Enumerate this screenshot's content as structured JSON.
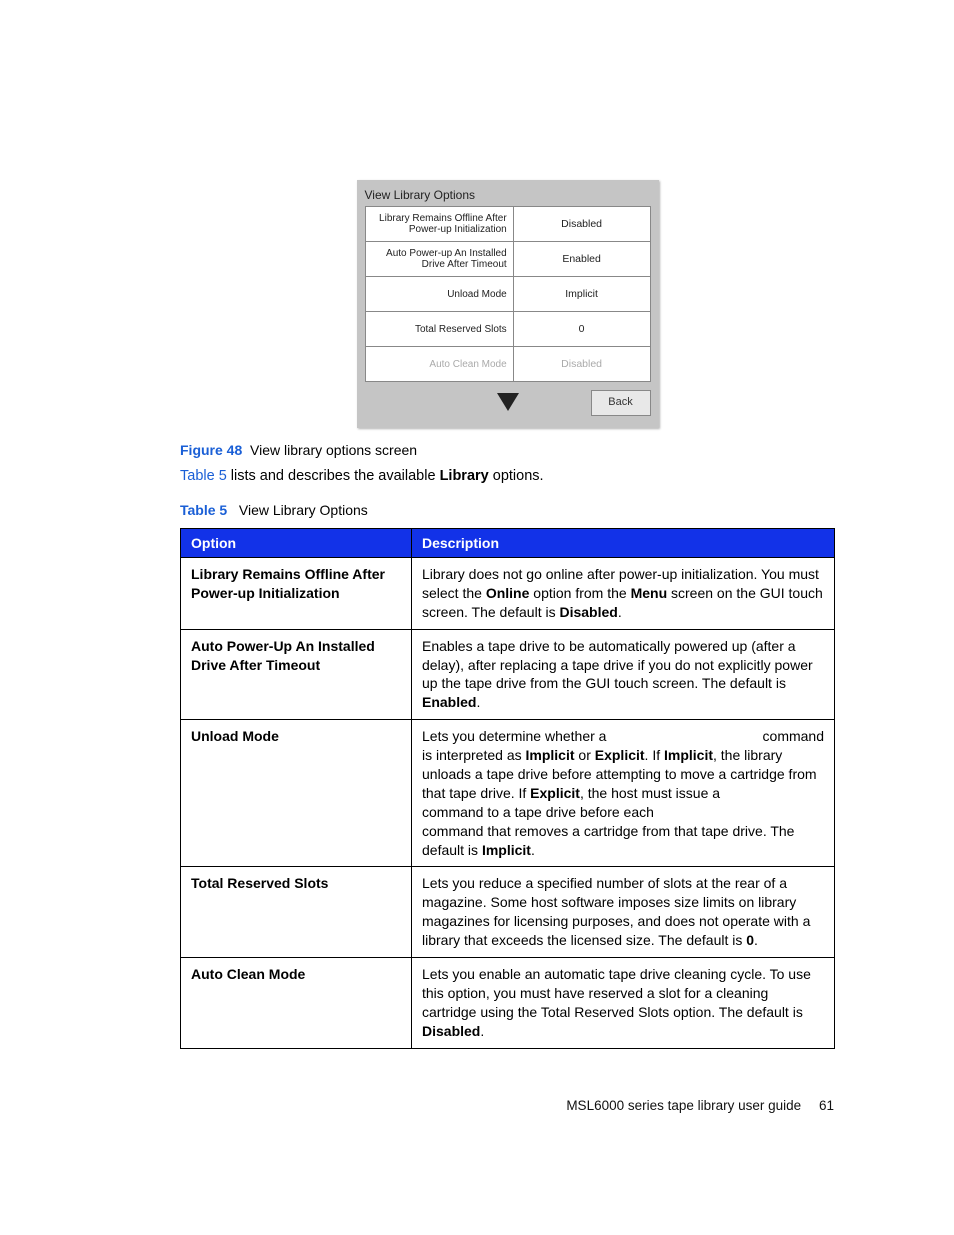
{
  "panel": {
    "title": "View Library Options",
    "rows": [
      {
        "label": "Library Remains Offline After\nPower-up Initialization",
        "value": "Disabled"
      },
      {
        "label": "Auto Power-up An Installed\nDrive After Timeout",
        "value": "Enabled"
      },
      {
        "label": "Unload Mode",
        "value": "Implicit"
      },
      {
        "label": "Total Reserved Slots",
        "value": "0"
      },
      {
        "label": "Auto Clean Mode",
        "value": "Disabled"
      }
    ],
    "back": "Back"
  },
  "figure": {
    "label": "Figure 48",
    "text": "View library options screen"
  },
  "bodytext": {
    "link": "Table 5",
    "mid": " lists and describes the available ",
    "bold": "Library",
    "tail": " options."
  },
  "tablecaption": {
    "label": "Table 5",
    "text": "View Library Options"
  },
  "table": {
    "headers": {
      "option": "Option",
      "description": "Description"
    },
    "rows": {
      "r0": {
        "option": "Library Remains Offline After Power-up Initialization",
        "d1": "Library does not go online after power-up initialization. You must select the ",
        "b1": "Online",
        "d2": " option from the ",
        "b2": "Menu",
        "d3": " screen on the GUI touch screen. The default is ",
        "b3": "Disabled",
        "d4": "."
      },
      "r1": {
        "option": "Auto Power-Up An Installed Drive After Timeout",
        "d1": "Enables a tape drive to be automatically powered up (after a delay), after replacing a tape drive if you do not explicitly power up the tape drive from the GUI touch screen. The default is ",
        "b1": "Enabled",
        "d2": "."
      },
      "r2": {
        "option": "Unload Mode",
        "p1a": "Lets you determine whether a ",
        "p1cmd": "command",
        "p2a": "is interpreted as ",
        "b1": "Implicit",
        "p2b": " or ",
        "b2": "Explicit",
        "p2c": ". If ",
        "b3": "Implicit",
        "p2d": ", the library unloads a tape drive before attempting to move a cartridge from that tape drive. If ",
        "b4": "Explicit",
        "p2e": ", the host must issue a ",
        "p3a": "command to a tape drive before each",
        "p4a": "command that removes a cartridge from that tape drive. The default is ",
        "b5": "Implicit",
        "p4b": "."
      },
      "r3": {
        "option": "Total Reserved Slots",
        "d1": "Lets you reduce a specified number of slots at the rear of a magazine. Some host software imposes size limits on library magazines for licensing purposes, and does not operate with a library that exceeds the licensed size. The default is ",
        "b1": "0",
        "d2": "."
      },
      "r4": {
        "option": "Auto Clean Mode",
        "d1": "Lets you enable an automatic tape drive cleaning cycle. To use this option, you must have reserved a slot for a cleaning cartridge using the Total Reserved Slots option. The default is ",
        "b1": "Disabled",
        "d2": "."
      }
    }
  },
  "footer": {
    "title": "MSL6000 series tape library user guide",
    "page": "61"
  }
}
